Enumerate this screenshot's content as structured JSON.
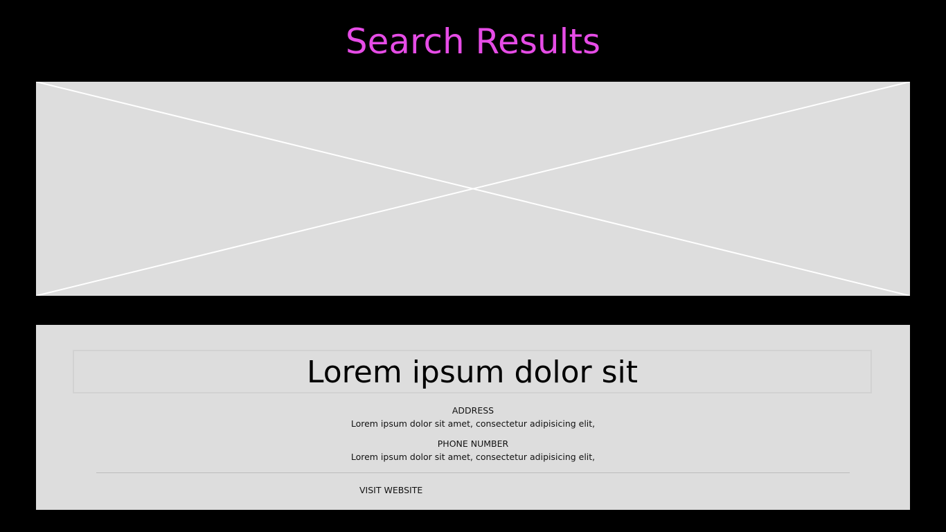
{
  "page": {
    "title": "Search Results",
    "title_color": "#e64ce6",
    "background_color": "#000000"
  },
  "hero": {
    "placeholder_color": "#dddddd",
    "icon": "image-placeholder-icon"
  },
  "result": {
    "title": "Lorem ipsum dolor sit",
    "address_label": "ADDRESS",
    "address_value": "Lorem ipsum dolor sit amet, consectetur adipisicing elit,",
    "phone_label": "PHONE NUMBER",
    "phone_value": "Lorem ipsum dolor sit amet, consectetur adipisicing elit,",
    "visit_label": "VISIT WEBSITE",
    "card_color": "#dddddd"
  }
}
